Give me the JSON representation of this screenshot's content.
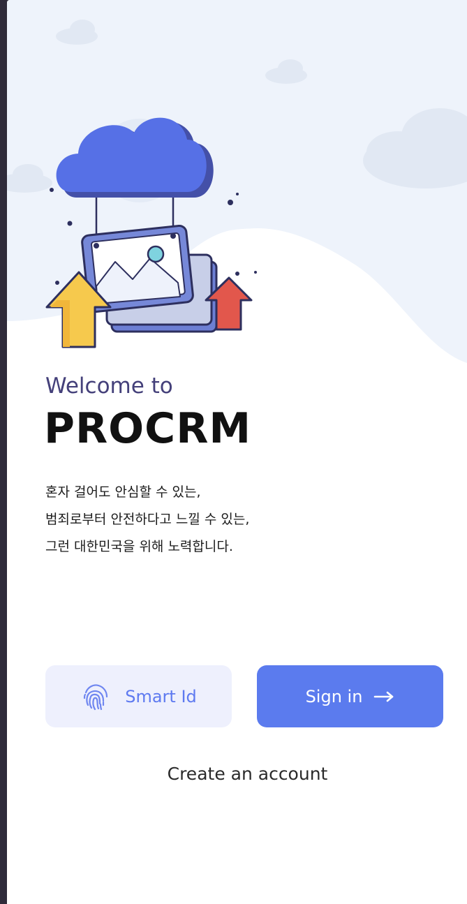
{
  "welcome_text": "Welcome to",
  "brand_name": "PROCRM",
  "tagline_lines": [
    "혼자 걸어도 안심할 수 있는,",
    "범죄로부터 안전하다고 느낄 수 있는,",
    "그런 대한민국을 위해 노력합니다."
  ],
  "buttons": {
    "smart_id_label": "Smart Id",
    "smart_id_icon": "fingerprint-icon",
    "sign_in_label": "Sign in",
    "sign_in_icon": "arrow-right-icon"
  },
  "create_account_label": "Create an account",
  "colors": {
    "accent": "#5b7bee",
    "accent_soft": "#eef0fd",
    "welcome_text": "#44407a",
    "background_art": "#eef3fb",
    "cloud": "#5670e6",
    "arrow_yellow": "#f6c94d",
    "arrow_red": "#e2574c"
  }
}
